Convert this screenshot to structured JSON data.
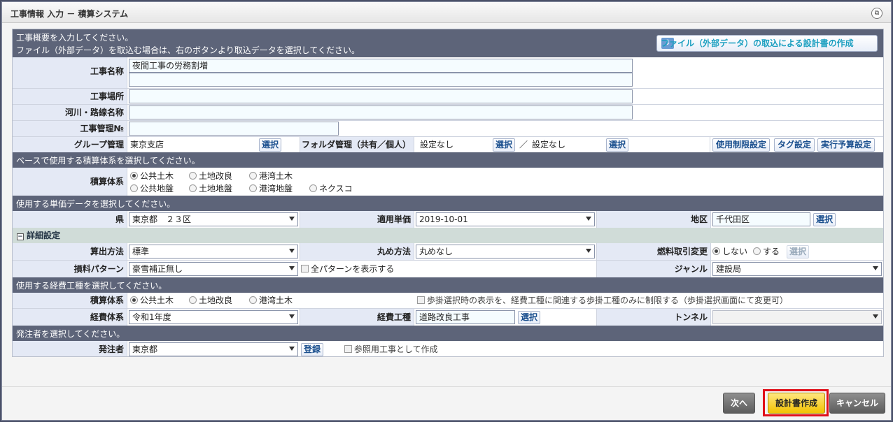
{
  "window": {
    "title": "工事情報 入力 － 積算システム"
  },
  "intro": {
    "line1": "工事概要を入力してください。",
    "line2": "ファイル（外部データ）を取込む場合は、右のボタンより取込データを選択してください。",
    "import_button": "ファイル（外部データ）の取込による設計書の作成"
  },
  "fields": {
    "koji_name_label": "工事名称",
    "koji_name_value": "夜間工事の労務割増",
    "koji_place_label": "工事場所",
    "river_route_label": "河川・路線名称",
    "koji_no_label": "工事管理№",
    "group_label": "グループ管理",
    "group_value": "東京支店",
    "select": "選択",
    "folder_label": "フォルダ管理（共有／個人）",
    "folder_shared": "設定なし",
    "folder_sep": "／",
    "folder_personal": "設定なし",
    "usage_limit_button": "使用制限設定",
    "tag_button": "タグ設定",
    "budget_button": "実行予算設定"
  },
  "base_system": {
    "header": "ベースで使用する積算体系を選択してください。",
    "label": "積算体系",
    "options": [
      "公共土木",
      "土地改良",
      "港湾土木",
      "公共地盤",
      "土地地盤",
      "港湾地盤",
      "ネクスコ"
    ],
    "selected": "公共土木"
  },
  "unit_price": {
    "header": "使用する単価データを選択してください。",
    "pref_label": "県",
    "pref_value": "東京都　２３区",
    "apply_label": "適用単価",
    "apply_value": "2019-10-01",
    "area_label": "地区",
    "area_value": "千代田区"
  },
  "details": {
    "header": "詳細設定",
    "calc_label": "算出方法",
    "calc_value": "標準",
    "round_label": "丸め方法",
    "round_value": "丸めなし",
    "fuel_label": "燃料取引変更",
    "fuel_no": "しない",
    "fuel_yes": "する",
    "loss_label": "損料パターン",
    "loss_value": "豪雪補正無し",
    "all_pattern": "全パターンを表示する",
    "genre_label": "ジャンル",
    "genre_value": "建設局"
  },
  "expense": {
    "header": "使用する経費工種を選択してください。",
    "system_label": "積算体系",
    "options": [
      "公共土木",
      "土地改良",
      "港湾土木"
    ],
    "selected": "公共土木",
    "restrict_check": "歩掛選択時の表示を、経費工種に関連する歩掛工種のみに制限する（歩掛選択画面にて変更可）",
    "exp_system_label": "経費体系",
    "exp_system_value": "令和1年度",
    "exp_type_label": "経費工種",
    "exp_type_value": "道路改良工事",
    "tunnel_label": "トンネル",
    "tunnel_value": ""
  },
  "orderer": {
    "header": "発注者を選択してください。",
    "label": "発注者",
    "value": "東京都",
    "register_button": "登録",
    "reference_check": "参照用工事として作成"
  },
  "footer": {
    "next": "次へ",
    "create": "設計書作成",
    "cancel": "キャンセル"
  }
}
